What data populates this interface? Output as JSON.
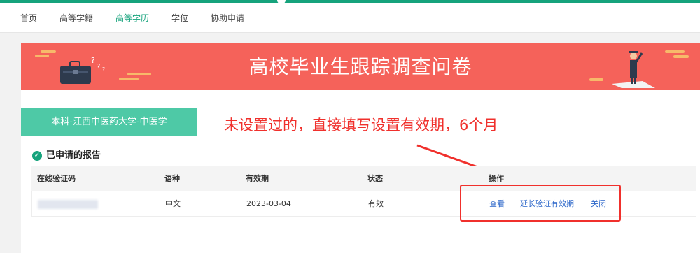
{
  "nav": {
    "items": [
      {
        "label": "首页",
        "active": false
      },
      {
        "label": "高等学籍",
        "active": false
      },
      {
        "label": "高等学历",
        "active": true
      },
      {
        "label": "学位",
        "active": false
      },
      {
        "label": "协助申请",
        "active": false
      }
    ]
  },
  "banner": {
    "title": "高校毕业生跟踪调查问卷"
  },
  "school_tab": {
    "label": "本科-江西中医药大学-中医学"
  },
  "annotation": {
    "text": "未设置过的，直接填写设置有效期，6个月"
  },
  "reports": {
    "heading": "已申请的报告",
    "columns": [
      "在线验证码",
      "语种",
      "有效期",
      "状态",
      "操作"
    ],
    "rows": [
      {
        "code": "",
        "language": "中文",
        "valid_until": "2023-03-04",
        "status": "有效",
        "actions": {
          "view": "查看",
          "extend": "延长验证有效期",
          "close": "关闭"
        }
      }
    ]
  },
  "colors": {
    "accent": "#16a37c",
    "banner": "#f5625a",
    "tab": "#4ec9a6",
    "link": "#2b66c9",
    "annotation": "#f0302c"
  }
}
